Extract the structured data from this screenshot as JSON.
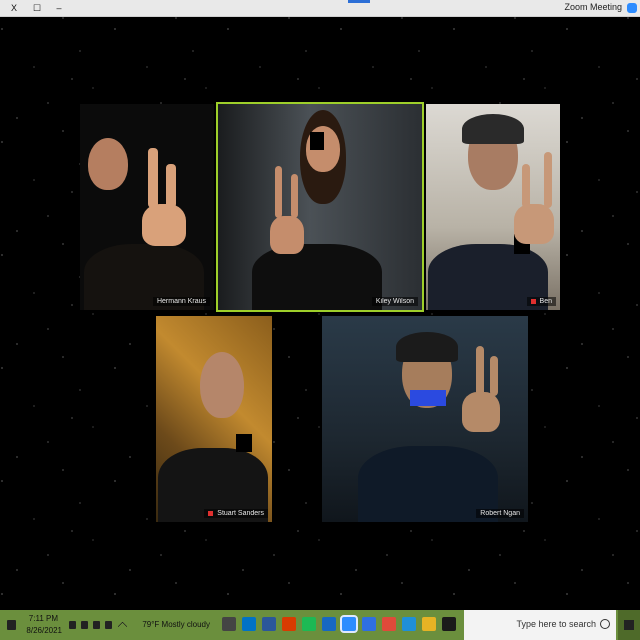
{
  "window": {
    "title": "Zoom Meeting",
    "close_label": "X",
    "maximize_label": "☐",
    "minimize_label": "–"
  },
  "participants": [
    {
      "id": "p1",
      "name": "Hermann Kraus",
      "muted": false
    },
    {
      "id": "p2",
      "name": "Kiley Wilson",
      "muted": false,
      "active_speaker": true
    },
    {
      "id": "p3",
      "name": "Ben",
      "muted": true
    },
    {
      "id": "p4",
      "name": "Stuart Sanders",
      "muted": true
    },
    {
      "id": "p5",
      "name": "Robert Ngan",
      "muted": false
    }
  ],
  "taskbar": {
    "search_placeholder": "Type here to search",
    "weather": "79°F Mostly cloudy",
    "time": "7:11 PM",
    "date": "8/26/2021",
    "icons": [
      "file-explorer-icon",
      "edge-icon",
      "chrome-icon",
      "store-icon",
      "zoom-icon",
      "mail-icon",
      "spotify-icon",
      "office-icon",
      "word-icon",
      "outlook-icon",
      "settings-icon"
    ]
  },
  "colors": {
    "active_border": "#9ecf2a",
    "taskbar_bg": "#6b8f3d",
    "zoom_blue": "#2d8cff"
  }
}
